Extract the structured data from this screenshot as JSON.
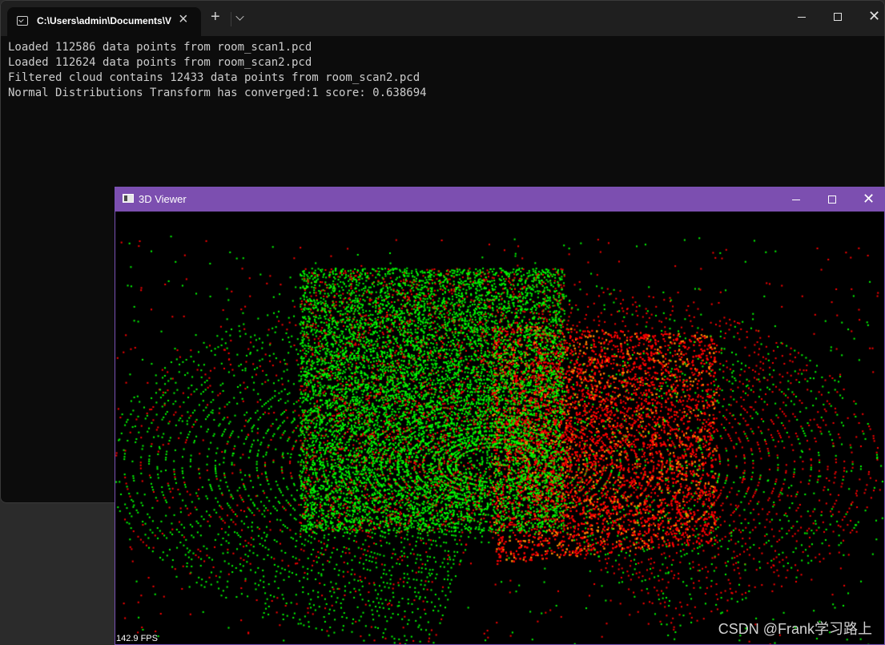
{
  "terminal": {
    "tab_title": "C:\\Users\\admin\\Documents\\V",
    "tab_close": "×",
    "new_tab": "+",
    "close_glyph": "✕",
    "lines": [
      "Loaded 112586 data points from room_scan1.pcd",
      "Loaded 112624 data points from room_scan2.pcd",
      "Filtered cloud contains 12433 data points from room_scan2.pcd",
      "Normal Distributions Transform has converged:1 score: 0.638694"
    ]
  },
  "viewer": {
    "title": "3D Viewer",
    "close_glyph": "✕",
    "fps": "142.9 FPS",
    "colors": {
      "target_cloud": "#ff0000",
      "aligned_cloud": "#00ff00",
      "titlebar": "#7c4fb0"
    }
  },
  "watermark": "CSDN @Frank学习路上"
}
